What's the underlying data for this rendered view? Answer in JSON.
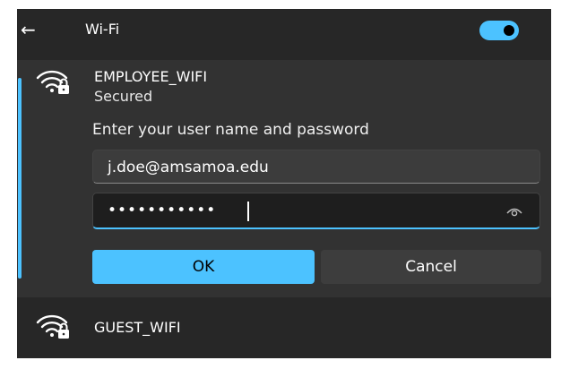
{
  "header": {
    "title": "Wi-Fi",
    "toggle_on": true,
    "accent_color": "#4cc2ff"
  },
  "networks": [
    {
      "name": "EMPLOYEE_WIFI",
      "status": "Secured",
      "icon": "wifi-secured-icon",
      "expanded": true,
      "prompt": "Enter your user name and password",
      "username_value": "j.doe@amsamoa.edu",
      "password_value": "•••••••••••",
      "ok_label": "OK",
      "cancel_label": "Cancel"
    },
    {
      "name": "GUEST_WIFI",
      "icon": "wifi-secured-icon",
      "expanded": false
    }
  ]
}
